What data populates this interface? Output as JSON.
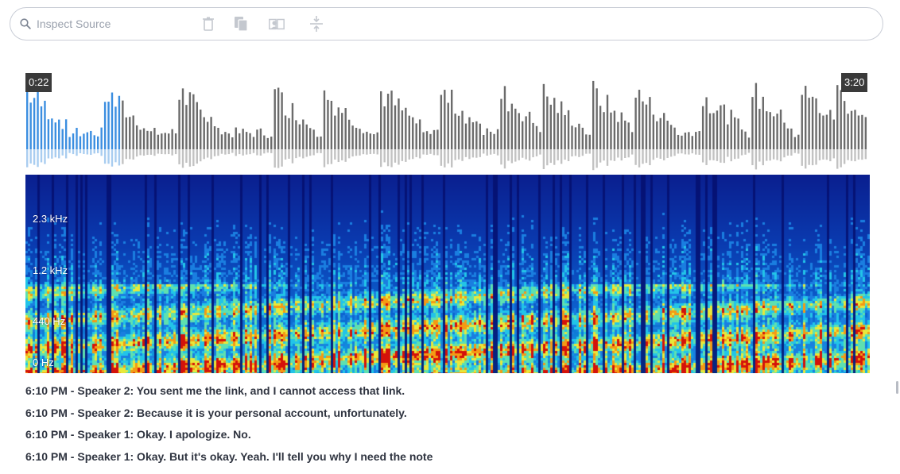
{
  "search": {
    "placeholder": "Inspect Source"
  },
  "toolbar": {
    "icons": [
      "trash-icon",
      "copy-icon",
      "read-icon",
      "collapse-icon"
    ]
  },
  "player": {
    "current_time": "0:22",
    "total_time": "3:20",
    "played_fraction": 0.11
  },
  "spectrogram": {
    "freq_labels": [
      "2.3 kHz",
      "1.2 kHz",
      "440 Hz",
      "0 Hz"
    ]
  },
  "transcript": [
    "6:10 PM - Speaker 2: You sent me the link, and I cannot access that link.",
    "6:10 PM - Speaker 2: Because it is your personal account, unfortunately.",
    "6:10 PM - Speaker 1: Okay. I apologize. No.",
    "6:10 PM - Speaker 1: Okay. But it's okay. Yeah. I'll tell you why I need the note"
  ],
  "colors": {
    "played": "#3b8ee0",
    "unplayed": "#6b6b6b",
    "badge_bg": "#3a3a3a"
  }
}
